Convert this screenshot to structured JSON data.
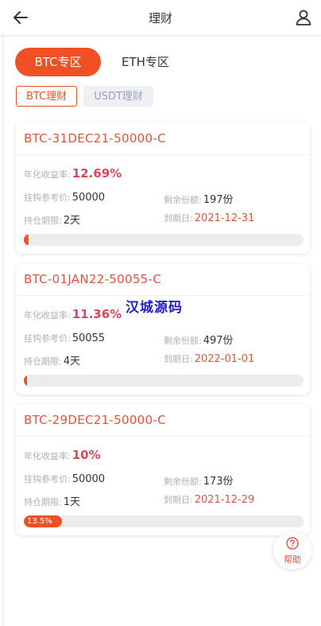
{
  "header": {
    "title": "理财"
  },
  "main_tabs": [
    {
      "label": "BTC专区"
    },
    {
      "label": "ETH专区"
    }
  ],
  "sub_tabs": [
    {
      "label": "BTC理财"
    },
    {
      "label": "USDT理财"
    }
  ],
  "labels": {
    "rate": "年化收益率:",
    "ref_price": "挂钩参考价:",
    "remaining": "剩余份额:",
    "period": "持仓期限:",
    "expiry": "到期日:"
  },
  "products": [
    {
      "name": "BTC-31DEC21-50000-C",
      "rate": "12.69%",
      "ref_price": "50000",
      "remaining": "197份",
      "period": "2天",
      "expiry": "2021-12-31",
      "progress": "1%"
    },
    {
      "name": "BTC-01JAN22-50055-C",
      "rate": "11.36%",
      "ref_price": "50055",
      "remaining": "497份",
      "period": "4天",
      "expiry": "2022-01-01",
      "progress": "0%"
    },
    {
      "name": "BTC-29DEC21-50000-C",
      "rate": "10%",
      "ref_price": "50000",
      "remaining": "173份",
      "period": "1天",
      "expiry": "2021-12-29",
      "progress": "13.5%"
    }
  ],
  "watermark": "汉城源码",
  "help": {
    "label": "帮助"
  }
}
